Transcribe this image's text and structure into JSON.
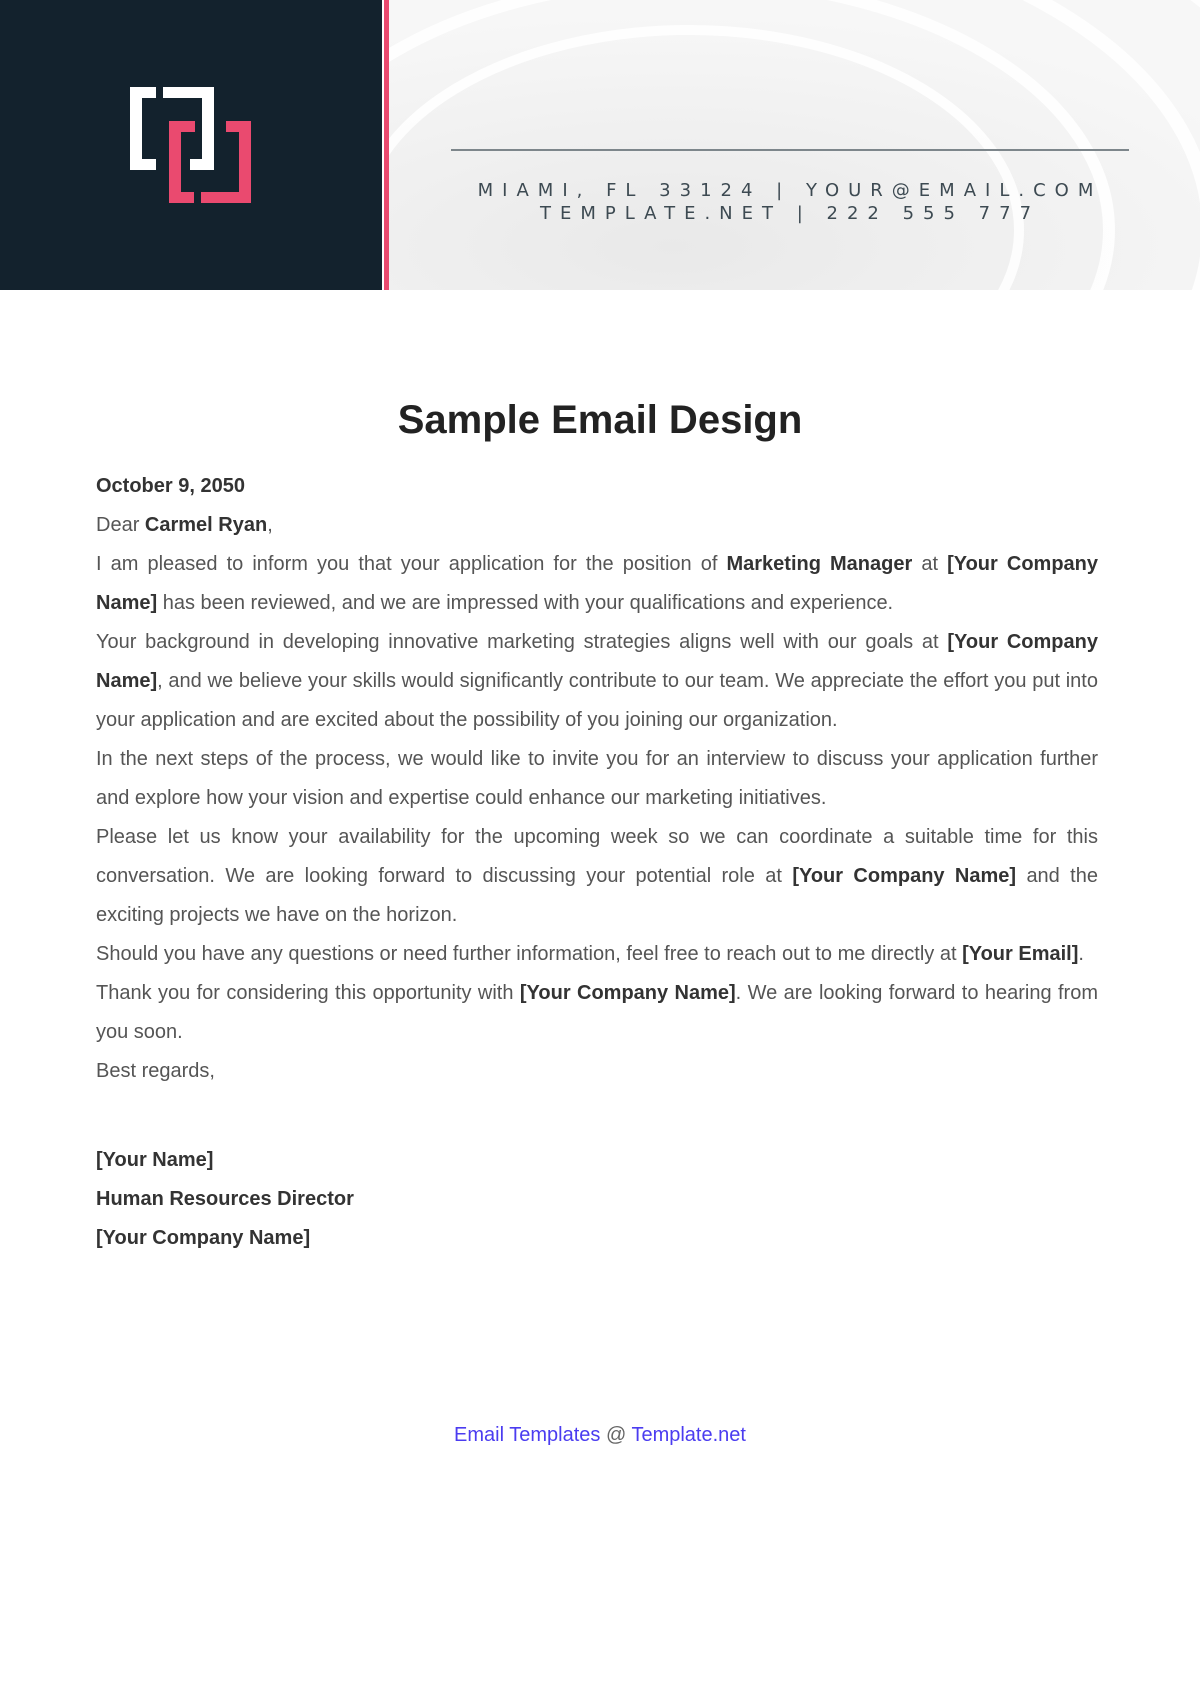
{
  "header": {
    "contact_line_1": "MIAMI, FL 33124 | YOUR@EMAIL.COM",
    "contact_line_2": "TEMPLATE.NET | 222 555 777",
    "colors": {
      "dark_panel": "#13222d",
      "accent": "#ea4a6f"
    }
  },
  "document": {
    "title": "Sample Email Design",
    "date": "October 9, 2050",
    "salutation_prefix": "Dear ",
    "recipient_name": "Carmel Ryan",
    "salutation_suffix": ",",
    "paragraphs": {
      "p1": {
        "a": "I am pleased to inform you that your application for the position of ",
        "b_position": "Marketing Manager",
        "c": " at ",
        "d_company": "[Your Company Name]",
        "e": " has been reviewed, and we are impressed with your qualifications and experience."
      },
      "p2": {
        "a": "Your background in developing innovative marketing strategies aligns well with our goals at ",
        "b_company": "[Your Company Name]",
        "c": ", and we believe your skills would significantly contribute to our team. We appreciate the effort you put into your application and are excited about the possibility of you joining our organization."
      },
      "p3": {
        "a": "In the next steps of the process, we would like to invite you for an interview to discuss your application further and explore how your vision and expertise could enhance our marketing initiatives."
      },
      "p4": {
        "a": "Please let us know your availability for the upcoming week so we can coordinate a suitable time for this conversation. We are looking forward to discussing your potential role at ",
        "b_company": "[Your Company Name]",
        "c": " and the exciting projects we have on the horizon."
      },
      "p5": {
        "a": "Should you have any questions or need further information, feel free to reach out to me directly at ",
        "b_email": "[Your Email]",
        "c": "."
      },
      "p6": {
        "a": "Thank you for considering this opportunity with ",
        "b_company": "[Your Company Name]",
        "c": ". We are looking forward to hearing from you soon."
      }
    },
    "closing": "Best regards,",
    "signature": {
      "name": "[Your Name]",
      "role": "Human Resources Director",
      "company": "[Your Company Name]"
    }
  },
  "footer": {
    "link_1": "Email Templates",
    "separator": " @ ",
    "link_2": "Template.net",
    "link_color": "#4b3cf0"
  }
}
